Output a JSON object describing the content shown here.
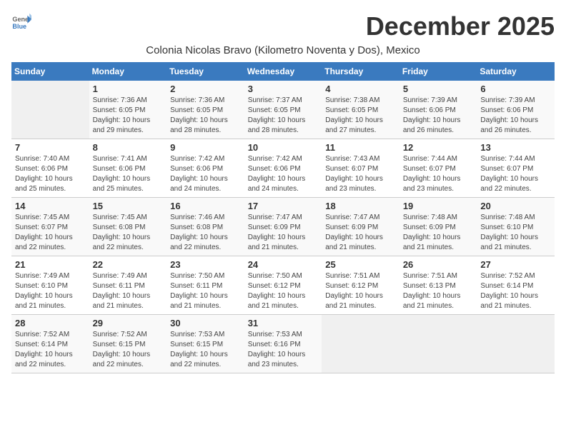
{
  "logo": {
    "general": "General",
    "blue": "Blue"
  },
  "title": "December 2025",
  "location": "Colonia Nicolas Bravo (Kilometro Noventa y Dos), Mexico",
  "days_of_week": [
    "Sunday",
    "Monday",
    "Tuesday",
    "Wednesday",
    "Thursday",
    "Friday",
    "Saturday"
  ],
  "weeks": [
    [
      {
        "day": "",
        "info": ""
      },
      {
        "day": "1",
        "info": "Sunrise: 7:36 AM\nSunset: 6:05 PM\nDaylight: 10 hours\nand 29 minutes."
      },
      {
        "day": "2",
        "info": "Sunrise: 7:36 AM\nSunset: 6:05 PM\nDaylight: 10 hours\nand 28 minutes."
      },
      {
        "day": "3",
        "info": "Sunrise: 7:37 AM\nSunset: 6:05 PM\nDaylight: 10 hours\nand 28 minutes."
      },
      {
        "day": "4",
        "info": "Sunrise: 7:38 AM\nSunset: 6:05 PM\nDaylight: 10 hours\nand 27 minutes."
      },
      {
        "day": "5",
        "info": "Sunrise: 7:39 AM\nSunset: 6:06 PM\nDaylight: 10 hours\nand 26 minutes."
      },
      {
        "day": "6",
        "info": "Sunrise: 7:39 AM\nSunset: 6:06 PM\nDaylight: 10 hours\nand 26 minutes."
      }
    ],
    [
      {
        "day": "7",
        "info": "Sunrise: 7:40 AM\nSunset: 6:06 PM\nDaylight: 10 hours\nand 25 minutes."
      },
      {
        "day": "8",
        "info": "Sunrise: 7:41 AM\nSunset: 6:06 PM\nDaylight: 10 hours\nand 25 minutes."
      },
      {
        "day": "9",
        "info": "Sunrise: 7:42 AM\nSunset: 6:06 PM\nDaylight: 10 hours\nand 24 minutes."
      },
      {
        "day": "10",
        "info": "Sunrise: 7:42 AM\nSunset: 6:06 PM\nDaylight: 10 hours\nand 24 minutes."
      },
      {
        "day": "11",
        "info": "Sunrise: 7:43 AM\nSunset: 6:07 PM\nDaylight: 10 hours\nand 23 minutes."
      },
      {
        "day": "12",
        "info": "Sunrise: 7:44 AM\nSunset: 6:07 PM\nDaylight: 10 hours\nand 23 minutes."
      },
      {
        "day": "13",
        "info": "Sunrise: 7:44 AM\nSunset: 6:07 PM\nDaylight: 10 hours\nand 22 minutes."
      }
    ],
    [
      {
        "day": "14",
        "info": "Sunrise: 7:45 AM\nSunset: 6:07 PM\nDaylight: 10 hours\nand 22 minutes."
      },
      {
        "day": "15",
        "info": "Sunrise: 7:45 AM\nSunset: 6:08 PM\nDaylight: 10 hours\nand 22 minutes."
      },
      {
        "day": "16",
        "info": "Sunrise: 7:46 AM\nSunset: 6:08 PM\nDaylight: 10 hours\nand 22 minutes."
      },
      {
        "day": "17",
        "info": "Sunrise: 7:47 AM\nSunset: 6:09 PM\nDaylight: 10 hours\nand 21 minutes."
      },
      {
        "day": "18",
        "info": "Sunrise: 7:47 AM\nSunset: 6:09 PM\nDaylight: 10 hours\nand 21 minutes."
      },
      {
        "day": "19",
        "info": "Sunrise: 7:48 AM\nSunset: 6:09 PM\nDaylight: 10 hours\nand 21 minutes."
      },
      {
        "day": "20",
        "info": "Sunrise: 7:48 AM\nSunset: 6:10 PM\nDaylight: 10 hours\nand 21 minutes."
      }
    ],
    [
      {
        "day": "21",
        "info": "Sunrise: 7:49 AM\nSunset: 6:10 PM\nDaylight: 10 hours\nand 21 minutes."
      },
      {
        "day": "22",
        "info": "Sunrise: 7:49 AM\nSunset: 6:11 PM\nDaylight: 10 hours\nand 21 minutes."
      },
      {
        "day": "23",
        "info": "Sunrise: 7:50 AM\nSunset: 6:11 PM\nDaylight: 10 hours\nand 21 minutes."
      },
      {
        "day": "24",
        "info": "Sunrise: 7:50 AM\nSunset: 6:12 PM\nDaylight: 10 hours\nand 21 minutes."
      },
      {
        "day": "25",
        "info": "Sunrise: 7:51 AM\nSunset: 6:12 PM\nDaylight: 10 hours\nand 21 minutes."
      },
      {
        "day": "26",
        "info": "Sunrise: 7:51 AM\nSunset: 6:13 PM\nDaylight: 10 hours\nand 21 minutes."
      },
      {
        "day": "27",
        "info": "Sunrise: 7:52 AM\nSunset: 6:14 PM\nDaylight: 10 hours\nand 21 minutes."
      }
    ],
    [
      {
        "day": "28",
        "info": "Sunrise: 7:52 AM\nSunset: 6:14 PM\nDaylight: 10 hours\nand 22 minutes."
      },
      {
        "day": "29",
        "info": "Sunrise: 7:52 AM\nSunset: 6:15 PM\nDaylight: 10 hours\nand 22 minutes."
      },
      {
        "day": "30",
        "info": "Sunrise: 7:53 AM\nSunset: 6:15 PM\nDaylight: 10 hours\nand 22 minutes."
      },
      {
        "day": "31",
        "info": "Sunrise: 7:53 AM\nSunset: 6:16 PM\nDaylight: 10 hours\nand 23 minutes."
      },
      {
        "day": "",
        "info": ""
      },
      {
        "day": "",
        "info": ""
      },
      {
        "day": "",
        "info": ""
      }
    ]
  ]
}
